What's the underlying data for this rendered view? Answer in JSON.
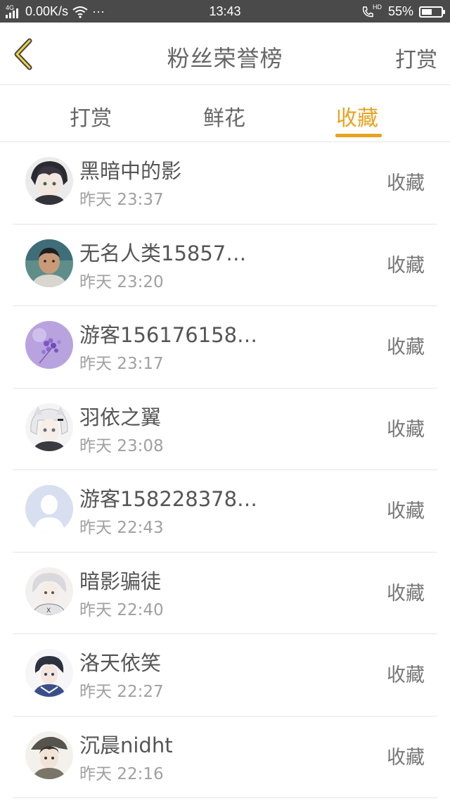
{
  "status_bar": {
    "network_tag": "4G",
    "speed": "0.00K/s",
    "more": "···",
    "time": "13:43",
    "battery": "55%",
    "battery_level": 0.55,
    "hd_tag": "HD"
  },
  "header": {
    "title": "粉丝荣誉榜",
    "action_label": "打赏",
    "accent_color": "#e8a320"
  },
  "tabs": [
    {
      "label": "打赏",
      "active": false
    },
    {
      "label": "鲜花",
      "active": false
    },
    {
      "label": "收藏",
      "active": true
    }
  ],
  "fans": [
    {
      "name": "黑暗中的影",
      "time": "昨天 23:37",
      "action": "收藏",
      "avatar_icon": "anime-character-avatar"
    },
    {
      "name": "无名人类15857…",
      "time": "昨天 23:20",
      "action": "收藏",
      "avatar_icon": "photo-child-avatar"
    },
    {
      "name": "游客156176158…",
      "time": "昨天 23:17",
      "action": "收藏",
      "avatar_icon": "lavender-flowers-avatar"
    },
    {
      "name": "羽依之翼",
      "time": "昨天 23:08",
      "action": "收藏",
      "avatar_icon": "anime-white-hair-avatar"
    },
    {
      "name": "游客158228378…",
      "time": "昨天 22:43",
      "action": "收藏",
      "avatar_icon": "default-person-avatar"
    },
    {
      "name": "暗影骗徒",
      "time": "昨天 22:40",
      "action": "收藏",
      "avatar_icon": "anime-silver-hair-avatar"
    },
    {
      "name": "洛天依笑",
      "time": "昨天 22:27",
      "action": "收藏",
      "avatar_icon": "anime-dark-hair-avatar"
    },
    {
      "name": "沉晨nidht",
      "time": "昨天 22:16",
      "action": "收藏",
      "avatar_icon": "anime-hat-avatar"
    }
  ]
}
